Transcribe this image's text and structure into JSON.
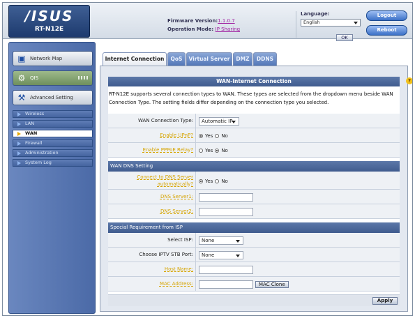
{
  "header": {
    "brand": "/ISUS",
    "model": "RT-N12E",
    "firmware_label": "Firmware Version:",
    "firmware_value": "1.1.0.7",
    "opmode_label": "Operation Mode:",
    "opmode_value": "IP Sharing",
    "language_label": "Language:",
    "language_value": "English",
    "ok_label": "OK",
    "logout_label": "Logout",
    "reboot_label": "Reboot"
  },
  "sidebar": {
    "main": [
      {
        "label": "Network Map",
        "icon": "network-map-icon"
      },
      {
        "label": "QIS",
        "icon": "qis-icon"
      },
      {
        "label": "Advanced Setting",
        "icon": "advanced-setting-icon"
      }
    ],
    "sub": [
      {
        "label": "Wireless"
      },
      {
        "label": "LAN"
      },
      {
        "label": "WAN",
        "active": true
      },
      {
        "label": "Firewall"
      },
      {
        "label": "Administration"
      },
      {
        "label": "System Log"
      }
    ]
  },
  "tabs": [
    "Internet Connection",
    "QoS",
    "Virtual Server",
    "DMZ",
    "DDNS"
  ],
  "panel": {
    "title": "WAN-Internet Connection",
    "intro": "RT-N12E supports several connection types to WAN. These types are selected from the dropdown menu beside WAN Connection Type. The setting fields differ depending on the connection type you selected.",
    "wan_type_label": "WAN Connection Type:",
    "wan_type_value": "Automatic IP",
    "upnp_label": "Enable UPnP?",
    "pppoe_relay_label": "Enable PPPoE Relay?",
    "yes": "Yes",
    "no": "No",
    "dns_section": "WAN DNS Setting",
    "dns_auto_label": "Connect to DNS Server automatically?",
    "dns1_label": "DNS Server1:",
    "dns2_label": "DNS Server2:",
    "isp_section": "Special Requirement from ISP",
    "select_isp_label": "Select ISP:",
    "select_isp_value": "None",
    "iptv_label": "Choose IPTV STB Port:",
    "iptv_value": "None",
    "host_label": "Host Name:",
    "mac_label": "MAC Address:",
    "mac_clone_label": "MAC Clone",
    "apply_label": "Apply"
  },
  "help_icon": "help-question-icon",
  "colors": {
    "accent_blue": "#3f5b8e",
    "link_yellow": "#d6a400",
    "button_blue": "#3b71c7"
  }
}
